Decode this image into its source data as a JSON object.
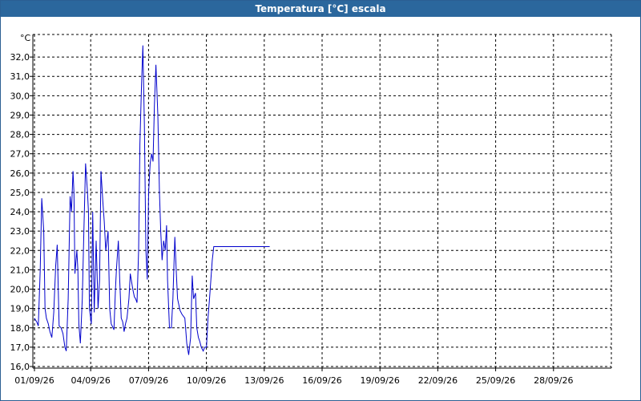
{
  "window": {
    "title": "Temperatura [°C] escala"
  },
  "colors": {
    "title_bar": "#2b679d",
    "series": "#0000cc",
    "grid": "#000000"
  },
  "chart_data": {
    "type": "line",
    "title": "Temperatura [°C] escala",
    "ylabel": "°C",
    "xlabel": "",
    "ylim": [
      16.0,
      33.0
    ],
    "xlim": [
      "01/09/26",
      "01/10/26"
    ],
    "y_ticks": [
      "16,0",
      "17,0",
      "18,0",
      "19,0",
      "20,0",
      "21,0",
      "22,0",
      "23,0",
      "24,0",
      "25,0",
      "26,0",
      "27,0",
      "28,0",
      "29,0",
      "30,0",
      "31,0",
      "32,0"
    ],
    "x_ticks": [
      "01/09/26",
      "04/09/26",
      "07/09/26",
      "10/09/26",
      "13/09/26",
      "16/09/26",
      "19/09/26",
      "22/09/26",
      "25/09/26",
      "28/09/26"
    ],
    "grid": true,
    "grid_style": "dashed",
    "legend": "none",
    "series": [
      {
        "x_unit": "days since 01/09/26",
        "x": [
          0.0,
          0.12,
          0.2,
          0.3,
          0.38,
          0.48,
          0.55,
          0.62,
          0.72,
          0.8,
          0.9,
          1.0,
          1.1,
          1.18,
          1.28,
          1.38,
          1.48,
          1.58,
          1.65,
          1.75,
          1.85,
          1.92,
          2.0,
          2.05,
          2.1,
          2.2,
          2.25,
          2.3,
          2.38,
          2.48,
          2.55,
          2.65,
          2.75,
          2.8,
          2.85,
          2.95,
          3.02,
          3.1,
          3.2,
          3.3,
          3.38,
          3.45,
          3.55,
          3.62,
          3.7,
          3.82,
          3.9,
          3.98,
          4.08,
          4.12,
          4.2,
          4.25,
          4.35,
          4.42,
          4.5,
          4.58,
          4.65,
          4.72,
          4.8,
          4.9,
          4.97,
          5.02,
          5.1,
          5.18,
          5.25,
          5.32,
          5.4,
          5.47,
          5.55,
          5.62,
          5.7,
          5.78,
          5.85,
          5.92,
          6.0,
          6.08,
          6.15,
          6.22,
          6.3,
          6.4,
          6.48,
          6.55,
          6.62,
          6.7,
          6.78,
          6.85,
          6.9,
          7.0,
          7.1,
          7.18,
          7.28,
          7.35,
          7.42,
          7.55,
          7.65,
          7.8,
          7.9,
          8.0,
          8.1,
          8.18,
          8.25,
          8.35,
          8.42,
          8.5,
          8.57,
          8.65,
          8.75,
          8.83,
          8.92,
          9.0,
          9.08,
          9.15,
          9.22,
          9.3,
          9.38,
          9.45,
          9.52,
          9.6,
          9.68,
          9.75,
          9.82,
          9.9,
          9.95,
          10.05,
          10.15,
          10.22,
          10.3,
          10.4,
          10.5,
          10.6,
          10.7,
          10.8,
          10.9,
          11.0,
          11.08,
          11.15,
          11.22,
          11.3,
          11.38,
          11.48,
          11.58,
          11.68,
          11.78,
          11.88,
          11.92,
          12.0,
          12.1,
          12.2
        ],
        "y": [
          18.5,
          18.3,
          18.1,
          21.0,
          24.7,
          23.0,
          19.0,
          18.5,
          18.2,
          17.8,
          17.5,
          18.8,
          21.2,
          22.3,
          18.1,
          18.0,
          17.7,
          17.0,
          16.8,
          19.5,
          24.8,
          24.0,
          26.1,
          25.0,
          20.8,
          22.0,
          21.0,
          18.2,
          17.2,
          19.5,
          22.5,
          26.5,
          25.0,
          24.0,
          19.0,
          18.2,
          24.0,
          18.8,
          22.5,
          19.0,
          20.5,
          26.1,
          24.5,
          23.5,
          22.0,
          23.0,
          19.0,
          18.2,
          18.0,
          17.9,
          20.0,
          21.0,
          22.5,
          20.5,
          18.5,
          18.3,
          17.8,
          18.2,
          18.5,
          19.5,
          20.8,
          20.5,
          20.0,
          19.6,
          19.5,
          19.3,
          22.0,
          27.5,
          30.5,
          32.6,
          28.5,
          22.0,
          20.5,
          25.0,
          26.5,
          27.0,
          26.6,
          29.5,
          31.6,
          29.0,
          25.0,
          23.0,
          21.5,
          22.5,
          22.0,
          23.3,
          20.5,
          18.0,
          18.0,
          19.5,
          22.7,
          21.0,
          19.5,
          18.9,
          18.7,
          18.5,
          17.2,
          16.6,
          17.5,
          20.7,
          19.5,
          19.8,
          18.0,
          17.5,
          17.3,
          17.0,
          16.8,
          17.0,
          17.0,
          18.5,
          19.5,
          20.5,
          21.5,
          22.2,
          22.2,
          22.2,
          22.2,
          22.2,
          22.2,
          22.2,
          22.2,
          22.2,
          22.2,
          22.2,
          22.2,
          22.2,
          22.2,
          22.2,
          22.2,
          22.2,
          22.2,
          22.2,
          22.2,
          22.2,
          22.2,
          22.2,
          22.2,
          22.2,
          22.2,
          22.2,
          22.2,
          22.2,
          22.2,
          22.2,
          22.2,
          22.2,
          22.2,
          22.2
        ]
      }
    ]
  }
}
